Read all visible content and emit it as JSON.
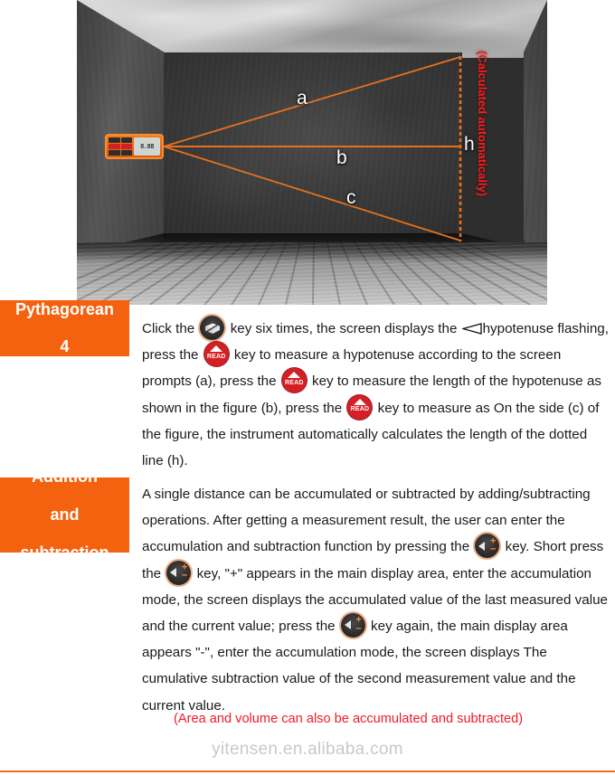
{
  "illustration": {
    "alt": "laser-distance-meter-pythagorean-measurement-room-diagram",
    "device_display": "8.88",
    "labels": {
      "a": "a",
      "b": "b",
      "c": "c",
      "h": "h"
    },
    "calculated_note": "(Calculated automatically)",
    "colors": {
      "laser_line": "#e8701c",
      "dotted_line": "#e8701c",
      "note_text": "#ff1a1a",
      "device_body": "#f07a20"
    }
  },
  "sections": [
    {
      "tag_lines": [
        "Pythagorean",
        "4"
      ],
      "text_runs": [
        {
          "t": "Click the "
        },
        {
          "icon": "volume-cube-key"
        },
        {
          "t": " key six times, the screen displays the "
        },
        {
          "icon": "hypotenuse-triangle"
        },
        {
          "t": "hypotenuse flashing, press the "
        },
        {
          "icon": "read-key"
        },
        {
          "t": " key to measure a hypotenuse according to the screen prompts (a), press the "
        },
        {
          "icon": "read-key"
        },
        {
          "t": " key to measure the length of the hypotenuse as shown in the figure (b), press the "
        },
        {
          "icon": "read-key"
        },
        {
          "t": " key to measure as On the side (c) of the figure, the instrument automatically calculates the length of the dotted line (h)."
        }
      ]
    },
    {
      "tag_lines": [
        "Addition",
        "and",
        "subtraction"
      ],
      "text_runs": [
        {
          "t": "A single distance can be accumulated or subtracted by adding/subtracting operations. After getting a measurement result, the user can enter the accumulation and subtraction function by pressing the "
        },
        {
          "icon": "plus-minus-key"
        },
        {
          "t": " key. Short press the "
        },
        {
          "icon": "plus-minus-key"
        },
        {
          "t": " key, \"+\" appears in the main display area, enter the accumulation mode, the screen displays the accumulated value of the last measured value and the current value; press the "
        },
        {
          "icon": "plus-minus-key"
        },
        {
          "t": " key again, the main display area appears \"-\", enter the accumulation mode, the screen displays The cumulative subtraction value of the second measurement value and the current value."
        }
      ],
      "red_note": "(Area and volume can also be accumulated and subtracted)"
    }
  ],
  "keys": {
    "read_label": "READ",
    "plus_symbol": "+",
    "minus_symbol": "−"
  },
  "watermark": "yitensen.en.alibaba.com",
  "theme": {
    "orange": "#f4620f",
    "footer_rule": "#ed6d23",
    "red": "#ef1a2a",
    "text": "#1a1a1a"
  }
}
